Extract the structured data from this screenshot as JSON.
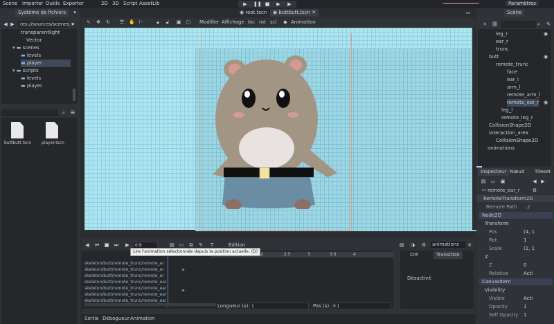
{
  "menu": {
    "scene": "Scène",
    "import": "Importer",
    "tools": "Outils",
    "export": "Exporter",
    "view2d": "2D",
    "view3d": "3D",
    "script": "Script",
    "assetlib": "AssetLib",
    "settings": "Paramètres"
  },
  "filesystem": {
    "tab": "Système de fichiers",
    "path": "res://sources/scenes",
    "tree": [
      "transparentlight",
      "Vector",
      "scenes",
      "levels",
      "player",
      "scripts",
      "levels",
      "player"
    ],
    "files": [
      "buttbutt.tscn",
      "player.tscn"
    ]
  },
  "editor_tabs": [
    "root.tscn",
    "buttbutt.tscn"
  ],
  "toolbar": {
    "modifier": "Modifier",
    "display": "Affichage",
    "loc": "loc",
    "rot": "rot",
    "scl": "scl",
    "animation": "Animation"
  },
  "scene": {
    "tab": "Scène",
    "nodes": [
      "leg_r",
      "ear_r",
      "trunc",
      "butt",
      "remote_trunc",
      "face",
      "ear_l",
      "arm_l",
      "remote_arm_l",
      "remote_ear_r",
      "leg_l",
      "remote_leg_r",
      "CollisionShape2D",
      "interaction_area",
      "CollisionShape2D",
      "animations"
    ]
  },
  "inspector": {
    "tabs": [
      "Inspecteur",
      "Nœud",
      "Tileset"
    ],
    "node": "remote_ear_r",
    "class": "RemoteTransform2D",
    "remote_path_label": "Remote Path",
    "remote_path_value": "../",
    "node2d": "Node2D",
    "transform": "Transform",
    "pos_label": "Pos",
    "pos_value": "(4, 1",
    "rot_label": "Rot",
    "rot_value": "1",
    "scale_label": "Scale",
    "scale_value": "(1, 1",
    "z": "Z",
    "z_label": "Z",
    "z_value": "0",
    "relative_label": "Relative",
    "relative_value": "Acti",
    "canvasitem": "CanvasItem",
    "visibility": "Visibility",
    "visible_label": "Visible",
    "visible_value": "Acti",
    "opacity_label": "Opacity",
    "opacity_value": "1",
    "self_opacity_label": "Self Opacity",
    "self_opacity_value": "1"
  },
  "animation": {
    "time": "0.9",
    "edit": "Édition",
    "tooltip": "Lire l'animation sélectionnée depuis la position actuelle. (D)",
    "anim_name": "animations",
    "ruler": [
      "2",
      "2.5",
      "3",
      "3.5",
      "4"
    ],
    "tracks": [
      "skeleton/butt/remote_trunc/remote_ar",
      "skeleton/butt/remote_trunc/remote_ar",
      "skeleton/butt/remote_trunc/remote_ar",
      "skeleton/butt/remote_trunc/remote_ear",
      "skeleton/butt/remote_trunc/remote_ear",
      "skeleton/butt/remote_trunc/remote_ear",
      "skeleton/butt/remote_trunc/remote_ear"
    ],
    "length_label": "Longueur (s) :",
    "length_value": "1",
    "step_label": "Pas (s) :",
    "step_value": "0.1",
    "blend_tabs": [
      "Cré",
      "Transition"
    ],
    "disabled": "Désactivé"
  },
  "bottom_tabs": [
    "Sortie",
    "Débogueur",
    "Animation"
  ],
  "colors": {
    "accent": "#6fa8dc",
    "canvas": "#aee4f0"
  }
}
